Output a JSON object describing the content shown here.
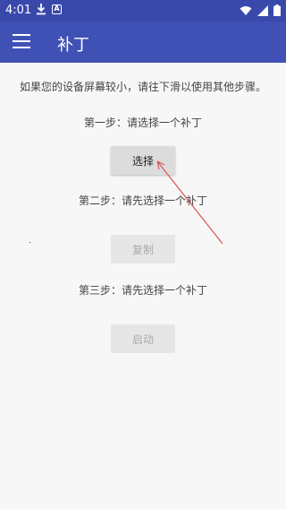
{
  "status_bar": {
    "time": "4:01",
    "a_icon": "A",
    "icons": [
      "download-icon",
      "a-icon",
      "wifi-icon",
      "signal-icon",
      "battery-icon"
    ]
  },
  "app_bar": {
    "title": "补丁",
    "menu_icon": "hamburger-menu-icon",
    "color": "#3f51b5"
  },
  "main": {
    "notice": "如果您的设备屏幕较小，请往下滑以使用其他步骤。",
    "step1_label": "第一步：请选择一个补丁",
    "select_button": "选择",
    "step2_label": "第二步：请先选择一个补丁",
    "copy_button": "复制",
    "step3_label": "第三步：请先选择一个补丁",
    "launch_button": "启动"
  },
  "annotation": {
    "type": "arrow",
    "color": "#d9534f"
  }
}
